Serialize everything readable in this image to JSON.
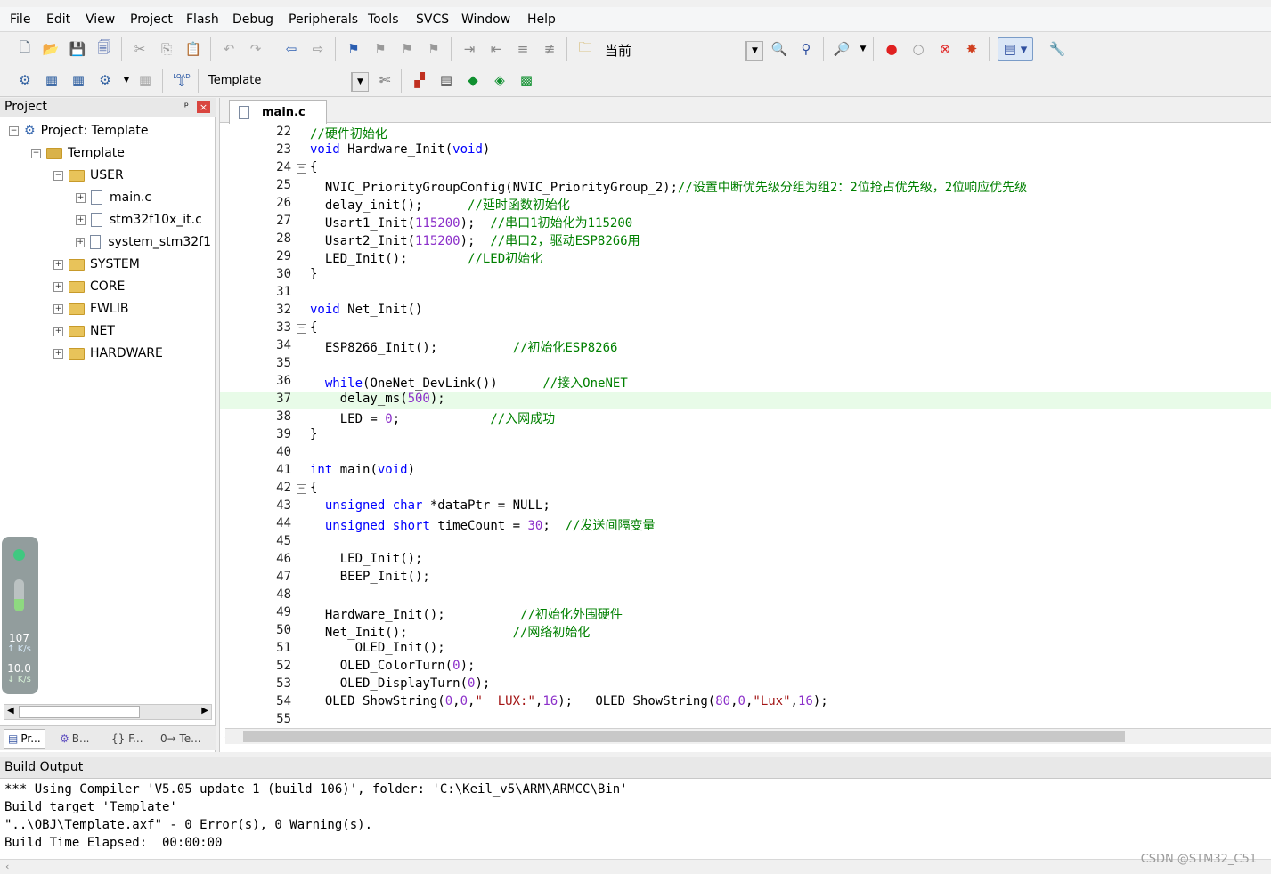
{
  "menu": [
    "File",
    "Edit",
    "View",
    "Project",
    "Flash",
    "Debug",
    "Peripherals",
    "Tools",
    "SVCS",
    "Window",
    "Help"
  ],
  "toolbar1": {
    "find_combo": "当前"
  },
  "toolbar2": {
    "target_combo": "Template",
    "load_icon_text": "LOAD"
  },
  "project_panel": {
    "title": "Project",
    "pin_glyph": "ᵖ",
    "close_glyph": "×",
    "tree": {
      "project": "Project: Template",
      "target": "Template",
      "group_user": "USER",
      "file_main": "main.c",
      "file_it": "stm32f10x_it.c",
      "file_system": "system_stm32f1",
      "groups": [
        "SYSTEM",
        "CORE",
        "FWLIB",
        "NET",
        "HARDWARE"
      ]
    },
    "tabs": [
      "Pr...",
      "B...",
      "{} F...",
      "0→ Te..."
    ]
  },
  "net_monitor": {
    "up_value": "107",
    "up_unit": "↑ K/s",
    "down_value": "10.0",
    "down_unit": "↓ K/s"
  },
  "editor": {
    "active_tab": "main.c",
    "highlight_line": 37,
    "lines": [
      {
        "n": "22",
        "t": "//硬件初始化"
      },
      {
        "n": "23",
        "t": "void Hardware_Init(void)"
      },
      {
        "n": "24",
        "t": "{"
      },
      {
        "n": "25",
        "t": "  NVIC_PriorityGroupConfig(NVIC_PriorityGroup_2);//设置中断优先级分组为组2：2位抢占优先级，2位响应优先级"
      },
      {
        "n": "26",
        "t": "  delay_init();      //延时函数初始化"
      },
      {
        "n": "27",
        "t": "  Usart1_Init(115200);  //串口1初始化为115200"
      },
      {
        "n": "28",
        "t": "  Usart2_Init(115200);  //串口2，驱动ESP8266用"
      },
      {
        "n": "29",
        "t": "  LED_Init();        //LED初始化"
      },
      {
        "n": "30",
        "t": "}"
      },
      {
        "n": "31",
        "t": ""
      },
      {
        "n": "32",
        "t": "void Net_Init()"
      },
      {
        "n": "33",
        "t": "{"
      },
      {
        "n": "34",
        "t": "  ESP8266_Init();          //初始化ESP8266"
      },
      {
        "n": "35",
        "t": ""
      },
      {
        "n": "36",
        "t": "  while(OneNet_DevLink())      //接入OneNET"
      },
      {
        "n": "37",
        "t": "    delay_ms(500);"
      },
      {
        "n": "38",
        "t": "    LED = 0;            //入网成功"
      },
      {
        "n": "39",
        "t": "}"
      },
      {
        "n": "40",
        "t": ""
      },
      {
        "n": "41",
        "t": "int main(void)"
      },
      {
        "n": "42",
        "t": "{"
      },
      {
        "n": "43",
        "t": "  unsigned char *dataPtr = NULL;"
      },
      {
        "n": "44",
        "t": "  unsigned short timeCount = 30;  //发送间隔变量"
      },
      {
        "n": "45",
        "t": ""
      },
      {
        "n": "46",
        "t": "    LED_Init();"
      },
      {
        "n": "47",
        "t": "    BEEP_Init();"
      },
      {
        "n": "48",
        "t": ""
      },
      {
        "n": "49",
        "t": "  Hardware_Init();          //初始化外围硬件"
      },
      {
        "n": "50",
        "t": "  Net_Init();              //网络初始化"
      },
      {
        "n": "51",
        "t": "      OLED_Init();"
      },
      {
        "n": "52",
        "t": "    OLED_ColorTurn(0);"
      },
      {
        "n": "53",
        "t": "    OLED_DisplayTurn(0);"
      },
      {
        "n": "54",
        "t": "  OLED_ShowString(0,0,\"  LUX:\",16);   OLED_ShowString(80,0,\"Lux\",16);"
      },
      {
        "n": "55",
        "t": ""
      }
    ]
  },
  "build_output": {
    "title": "Build Output",
    "lines": [
      "*** Using Compiler 'V5.05 update 1 (build 106)', folder: 'C:\\Keil_v5\\ARM\\ARMCC\\Bin'",
      "Build target 'Template'",
      "\"..\\OBJ\\Template.axf\" - 0 Error(s), 0 Warning(s).",
      "Build Time Elapsed:  00:00:00"
    ]
  },
  "watermark": "CSDN @STM32_C51"
}
